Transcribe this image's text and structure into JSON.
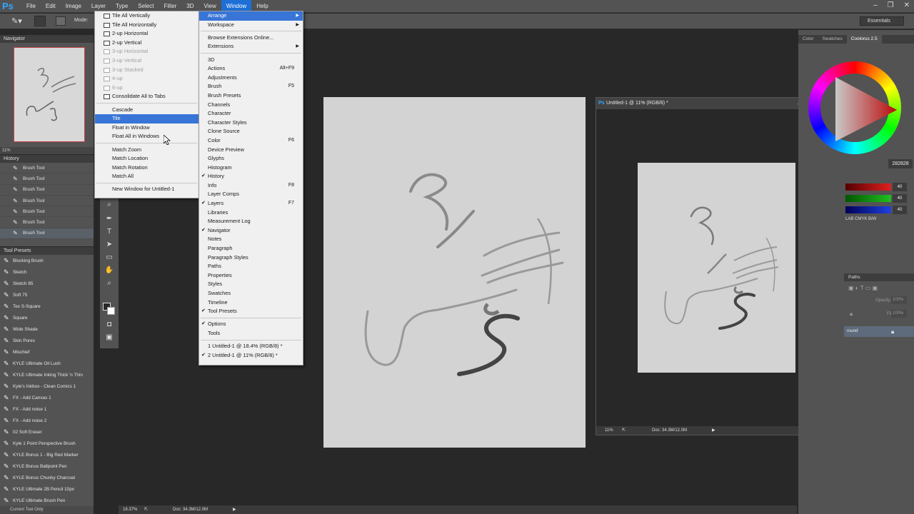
{
  "app": {
    "logo": "Ps"
  },
  "menubar": {
    "items": [
      "File",
      "Edit",
      "Image",
      "Layer",
      "Type",
      "Select",
      "Filter",
      "3D",
      "View",
      "Window",
      "Help"
    ],
    "active": "Window"
  },
  "optionsbar": {
    "mode_label": "Mode:",
    "workspace": "Essentials"
  },
  "navigator": {
    "tab": "Navigator",
    "zoom": "11%"
  },
  "history": {
    "tab": "History",
    "items": [
      "Brush Tool",
      "Brush Tool",
      "Brush Tool",
      "Brush Tool",
      "Brush Tool",
      "Brush Tool",
      "Brush Tool"
    ]
  },
  "tool_presets": {
    "tab": "Tool Presets",
    "items": [
      "Blocking Brush",
      "Sketch",
      "Sketch 85",
      "Soft 75",
      "Tex S-Square",
      "Square",
      "Wide Shade",
      "Skin Pores",
      "Mischief",
      "KYLE Ultimate Oil Lush",
      "KYLE Ultimate Inking Thick 'n Thin",
      "Kyle's Inkbox - Clean Comics 1",
      "FX - Add Canvas 1",
      "FX - Add noise 1",
      "FX - Add noise 2",
      "02 Soft Eraser",
      "Kyle 1 Point Perspective Brush",
      "KYLE Bonus 1 - Big Red Marker",
      "KYLE Bonus Ballpoint Pen",
      "KYLE Bonus Chunky Charcoal",
      "KYLE Ultimate 2B Pencil 10px",
      "KYLE Ultimate Brush Pen"
    ],
    "footer": "Current Tool Only"
  },
  "window_menu": {
    "top": [
      {
        "label": "Arrange",
        "arrow": true,
        "hl": true
      },
      {
        "label": "Workspace",
        "arrow": true
      }
    ],
    "ext": [
      {
        "label": "Browse Extensions Online..."
      },
      {
        "label": "Extensions",
        "arrow": true
      }
    ],
    "panels": [
      {
        "label": "3D"
      },
      {
        "label": "Actions",
        "sc": "Alt+F9"
      },
      {
        "label": "Adjustments"
      },
      {
        "label": "Brush",
        "sc": "F5"
      },
      {
        "label": "Brush Presets"
      },
      {
        "label": "Channels"
      },
      {
        "label": "Character"
      },
      {
        "label": "Character Styles"
      },
      {
        "label": "Clone Source"
      },
      {
        "label": "Color",
        "sc": "F6"
      },
      {
        "label": "Device Preview"
      },
      {
        "label": "Glyphs"
      },
      {
        "label": "Histogram"
      },
      {
        "label": "History",
        "check": true
      },
      {
        "label": "Info",
        "sc": "F8"
      },
      {
        "label": "Layer Comps"
      },
      {
        "label": "Layers",
        "check": true,
        "sc": "F7"
      },
      {
        "label": "Libraries"
      },
      {
        "label": "Measurement Log"
      },
      {
        "label": "Navigator",
        "check": true
      },
      {
        "label": "Notes"
      },
      {
        "label": "Paragraph"
      },
      {
        "label": "Paragraph Styles"
      },
      {
        "label": "Paths"
      },
      {
        "label": "Properties"
      },
      {
        "label": "Styles"
      },
      {
        "label": "Swatches"
      },
      {
        "label": "Timeline"
      },
      {
        "label": "Tool Presets",
        "check": true
      }
    ],
    "bars": [
      {
        "label": "Options",
        "check": true
      },
      {
        "label": "Tools"
      }
    ],
    "docs": [
      {
        "label": "1 Untitled-1 @ 18.4% (RGB/8) *"
      },
      {
        "label": "2 Untitled-1 @ 11% (RGB/8) *",
        "check": true
      }
    ]
  },
  "arrange_menu": {
    "group1": [
      {
        "label": "Tile All Vertically",
        "icon": true
      },
      {
        "label": "Tile All Horizontally",
        "icon": true
      },
      {
        "label": "2-up Horizontal",
        "icon": true
      },
      {
        "label": "2-up Vertical",
        "icon": true
      },
      {
        "label": "3-up Horizontal",
        "icon": true,
        "dis": true
      },
      {
        "label": "3-up Vertical",
        "icon": true,
        "dis": true
      },
      {
        "label": "3-up Stacked",
        "icon": true,
        "dis": true
      },
      {
        "label": "4-up",
        "icon": true,
        "dis": true
      },
      {
        "label": "6-up",
        "icon": true,
        "dis": true
      },
      {
        "label": "Consolidate All to Tabs",
        "icon": true
      }
    ],
    "group2": [
      {
        "label": "Cascade"
      },
      {
        "label": "Tile",
        "hl": true
      },
      {
        "label": "Float in Window"
      },
      {
        "label": "Float All in Windows"
      }
    ],
    "group3": [
      {
        "label": "Match Zoom"
      },
      {
        "label": "Match Location"
      },
      {
        "label": "Match Rotation"
      },
      {
        "label": "Match All"
      }
    ],
    "group4": [
      {
        "label": "New Window for Untitled-1"
      }
    ]
  },
  "main_doc": {
    "zoom": "18.37%",
    "doc_info": "Doc: 34.3M/12.0M"
  },
  "float_doc": {
    "title": "Untitled-1 @ 11% (RGB/8) *",
    "zoom": "11%",
    "doc_info": "Doc: 34.3M/12.0M"
  },
  "right_panel": {
    "tabs": [
      "Color",
      "Swatches",
      "Coolorus 2.5"
    ],
    "hex": "282828",
    "rgb": [
      {
        "value": "40",
        "color": "#e02020"
      },
      {
        "value": "40",
        "color": "#20c020"
      },
      {
        "value": "40",
        "color": "#2040e0"
      }
    ],
    "modes": "LAB CMYK B/W",
    "layers_tab": "Paths",
    "opacity_label": "Opacity:",
    "opacity_val": "100%",
    "fill_label": "Fill:",
    "fill_val": "100%",
    "layer_name": "round"
  }
}
